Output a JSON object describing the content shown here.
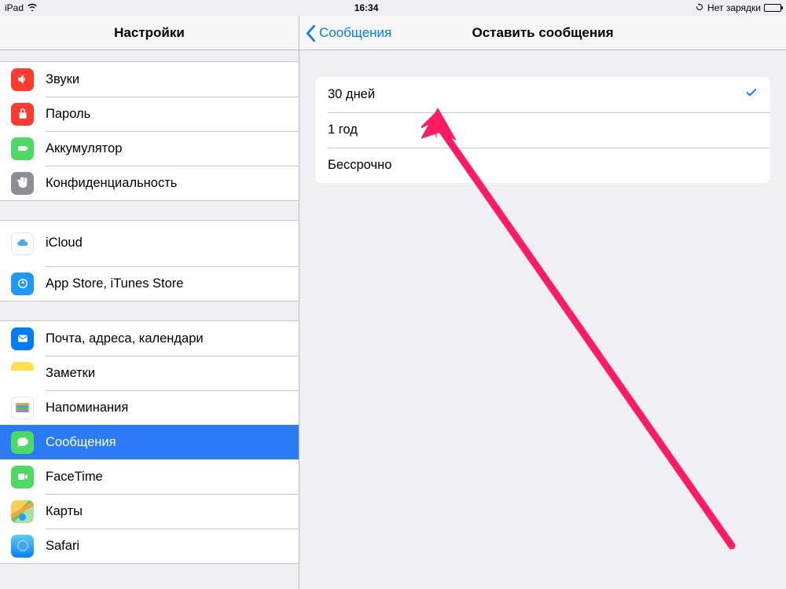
{
  "status": {
    "device": "iPad",
    "time": "16:34",
    "charge_text": "Нет зарядки"
  },
  "sidebar": {
    "title": "Настройки",
    "group1": [
      {
        "name": "sounds",
        "label": "Звуки"
      },
      {
        "name": "passcode",
        "label": "Пароль"
      },
      {
        "name": "battery",
        "label": "Аккумулятор"
      },
      {
        "name": "privacy",
        "label": "Конфиденциальность"
      }
    ],
    "group2": [
      {
        "name": "icloud",
        "label": "iCloud",
        "sub": ""
      },
      {
        "name": "itunes",
        "label": "App Store, iTunes Store"
      }
    ],
    "group3": [
      {
        "name": "mail",
        "label": "Почта, адреса, календари"
      },
      {
        "name": "notes",
        "label": "Заметки"
      },
      {
        "name": "reminders",
        "label": "Напоминания"
      },
      {
        "name": "messages",
        "label": "Сообщения"
      },
      {
        "name": "facetime",
        "label": "FaceTime"
      },
      {
        "name": "maps",
        "label": "Карты"
      },
      {
        "name": "safari",
        "label": "Safari"
      }
    ]
  },
  "detail": {
    "back_label": "Сообщения",
    "title": "Оставить сообщения",
    "options": [
      {
        "label": "30 дней",
        "selected": true
      },
      {
        "label": "1 год",
        "selected": false
      },
      {
        "label": "Бессрочно",
        "selected": false
      }
    ]
  },
  "colors": {
    "accent": "#007aff",
    "arrow": "#ff1a64"
  }
}
